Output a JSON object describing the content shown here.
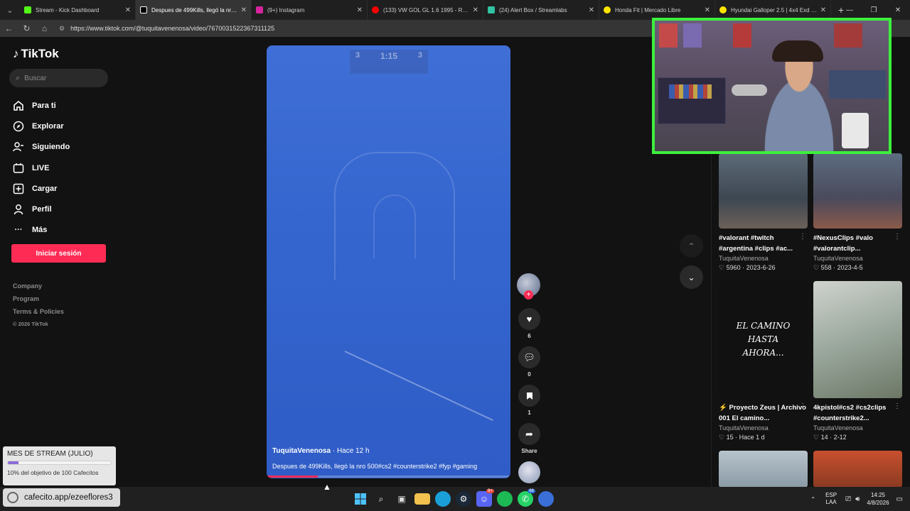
{
  "browser": {
    "tabs": [
      {
        "title": "Stream - Kick Dashboard",
        "color": "#53fc18"
      },
      {
        "title": "Despues de 499Kills, llegó la nro 5",
        "color": "#000000"
      },
      {
        "title": "(9+) Instagram",
        "color": "#d6249f"
      },
      {
        "title": "(133) VW GOL GL 1.6 1995 - RETR",
        "color": "#ff0000"
      },
      {
        "title": "(24) Alert Box / Streamlabs",
        "color": "#31c3a2"
      },
      {
        "title": "Honda Fit | Mercado Libre",
        "color": "#ffe600"
      },
      {
        "title": "Hyundai Galloper 2.5 | 4x4 Exd | M",
        "color": "#ffe600"
      }
    ],
    "url": "https://www.tiktok.com/@tuquitavenenosa/video/7670031522367311125"
  },
  "sidebar": {
    "logo": "TikTok",
    "search_placeholder": "Buscar",
    "items": [
      {
        "label": "Para ti",
        "icon": "home-icon"
      },
      {
        "label": "Explorar",
        "icon": "compass-icon"
      },
      {
        "label": "Siguiendo",
        "icon": "following-icon"
      },
      {
        "label": "LIVE",
        "icon": "live-icon"
      },
      {
        "label": "Cargar",
        "icon": "upload-icon"
      },
      {
        "label": "Perfil",
        "icon": "profile-icon"
      },
      {
        "label": "Más",
        "icon": "more-icon"
      }
    ],
    "login": "Iniciar sesión",
    "footer": [
      "Company",
      "Program",
      "Terms & Policies"
    ],
    "copyright": "© 2026 TikTok"
  },
  "video": {
    "hud_left": "3",
    "hud_time": "1:15",
    "hud_right": "3",
    "author": "TuquitaVenenosa",
    "time_ago": " · Hace 12 h",
    "caption": "Despues de 499Kills, llegó la nro 500#cs2 #counterstrike2 #fyp #gaming",
    "progress": 0.21
  },
  "actions": {
    "likes": "6",
    "comments": "0",
    "saves": "1",
    "share": "Share"
  },
  "related": [
    {
      "title": "#valorant #twitch #argentina #clips #ac...",
      "author": "TuquitaVenenosa",
      "likes": "5960",
      "date": "2023-6-26"
    },
    {
      "title": "#NexusClips #valo #valorantclip...",
      "author": "TuquitaVenenosa",
      "likes": "558",
      "date": "2023-4-5"
    },
    {
      "title": "Proyecto Zeus | Archivo 001 El camino...",
      "author": "TuquitaVenenosa",
      "likes": "15",
      "date": "Hace 1 d",
      "thumb_text": "EL CAMINO HASTA AHORA..."
    },
    {
      "title": "4kpistol#cs2 #cs2clips #counterstrike2...",
      "author": "TuquitaVenenosa",
      "likes": "14",
      "date": "2-12"
    }
  ],
  "overlay": {
    "goal_title": "MES DE STREAM (JULIO)",
    "goal_status": "10% del objetivo de 100 Cafecitos",
    "goal_progress": 0.1,
    "cafecito": "cafecito.app/ezeeflores3"
  },
  "taskbar": {
    "lang_top": "ESP",
    "lang_bottom": "LAA",
    "time": "14:25",
    "date": "4/8/2026",
    "discord_badge": "9+",
    "whatsapp_badge": "66"
  }
}
